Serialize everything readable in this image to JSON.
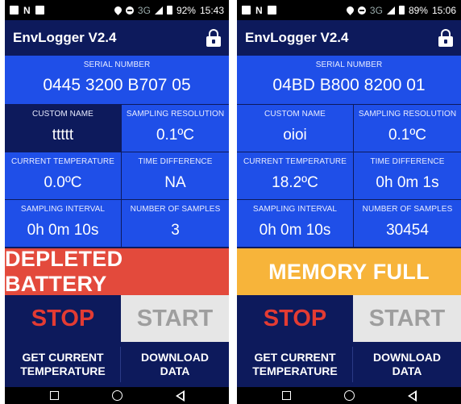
{
  "screens": [
    {
      "status": {
        "network": "3G",
        "battery": "92%",
        "time": "15:43"
      },
      "app_title": "EnvLogger V2.4",
      "serial": {
        "label": "SERIAL NUMBER",
        "value": "0445 3200 B707 05"
      },
      "custom_name": {
        "label": "CUSTOM NAME",
        "value": "ttttt"
      },
      "sampling_resolution": {
        "label": "SAMPLING RESOLUTION",
        "value": "0.1ºC"
      },
      "current_temperature": {
        "label": "CURRENT TEMPERATURE",
        "value": "0.0ºC"
      },
      "time_difference": {
        "label": "TIME DIFFERENCE",
        "value": "NA"
      },
      "sampling_interval": {
        "label": "SAMPLING INTERVAL",
        "value": "0h 0m 10s"
      },
      "number_of_samples": {
        "label": "NUMBER OF SAMPLES",
        "value": "3"
      },
      "alert": {
        "text": "DEPLETED BATTERY",
        "color": "#e34a3c"
      },
      "stop_label": "STOP",
      "start_label": "START",
      "get_temp_label": [
        "GET CURRENT",
        "TEMPERATURE"
      ],
      "download_label": [
        "DOWNLOAD",
        "DATA"
      ]
    },
    {
      "status": {
        "network": "3G",
        "battery": "89%",
        "time": "15:06"
      },
      "app_title": "EnvLogger V2.4",
      "serial": {
        "label": "SERIAL NUMBER",
        "value": "04BD B800 8200 01"
      },
      "custom_name": {
        "label": "CUSTOM NAME",
        "value": "oioi"
      },
      "sampling_resolution": {
        "label": "SAMPLING RESOLUTION",
        "value": "0.1ºC"
      },
      "current_temperature": {
        "label": "CURRENT TEMPERATURE",
        "value": "18.2ºC"
      },
      "time_difference": {
        "label": "TIME DIFFERENCE",
        "value": "0h 0m 1s"
      },
      "sampling_interval": {
        "label": "SAMPLING INTERVAL",
        "value": "0h 0m 10s"
      },
      "number_of_samples": {
        "label": "NUMBER OF SAMPLES",
        "value": "30454"
      },
      "alert": {
        "text": "MEMORY FULL",
        "color": "#f7b43a"
      },
      "stop_label": "STOP",
      "start_label": "START",
      "get_temp_label": [
        "GET CURRENT",
        "TEMPERATURE"
      ],
      "download_label": [
        "DOWNLOAD",
        "DATA"
      ]
    }
  ],
  "colors": {
    "primary": "#1f4fe8",
    "dark": "#0d1a5c",
    "stop": "#e33b33",
    "start_bg": "#e6e6e6"
  }
}
